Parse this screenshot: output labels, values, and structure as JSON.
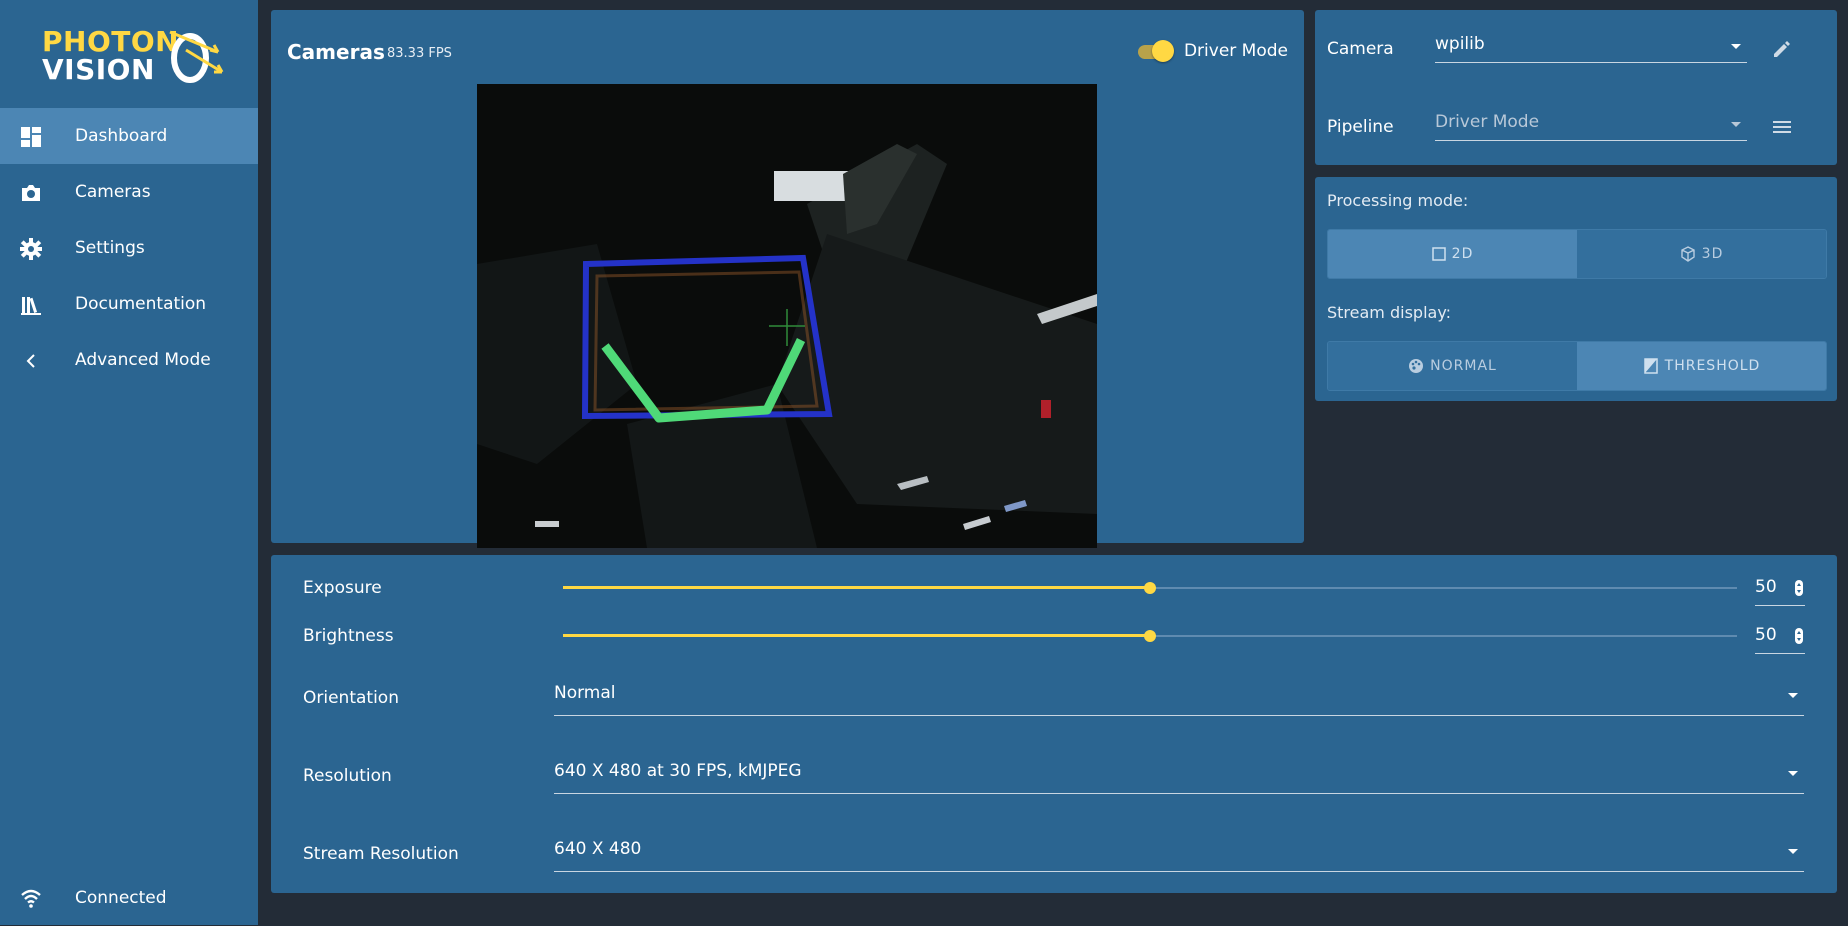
{
  "app": {
    "logo_line1": "PHOTON",
    "logo_line2": "VISION",
    "brand_color": "#ffd843",
    "primary_color": "#2b6591",
    "background_color": "#232c37"
  },
  "sidebar": {
    "items": [
      {
        "label": "Dashboard",
        "icon": "dashboard-icon",
        "active": true
      },
      {
        "label": "Cameras",
        "icon": "camera-icon",
        "active": false
      },
      {
        "label": "Settings",
        "icon": "gear-icon",
        "active": false
      },
      {
        "label": "Documentation",
        "icon": "books-icon",
        "active": false
      },
      {
        "label": "Advanced Mode",
        "icon": "chevron-left-icon",
        "active": false
      }
    ],
    "status": {
      "label": "Connected",
      "icon": "wifi-icon"
    }
  },
  "camera_panel": {
    "title": "Cameras",
    "fps": "83.33 FPS",
    "driver_mode_label": "Driver Mode",
    "driver_mode_on": true
  },
  "camera_settings": {
    "camera_label": "Camera",
    "camera_value": "wpilib",
    "pipeline_label": "Pipeline",
    "pipeline_value": "Driver Mode"
  },
  "modes": {
    "processing_label": "Processing mode:",
    "processing_options": [
      "2D",
      "3D"
    ],
    "processing_selected": "2D",
    "stream_label": "Stream display:",
    "stream_options": [
      "NORMAL",
      "THRESHOLD"
    ],
    "stream_selected": "THRESHOLD"
  },
  "controls": {
    "exposure_label": "Exposure",
    "exposure_value": "50",
    "exposure_fraction": 0.5,
    "brightness_label": "Brightness",
    "brightness_value": "50",
    "brightness_fraction": 0.5,
    "orientation_label": "Orientation",
    "orientation_value": "Normal",
    "resolution_label": "Resolution",
    "resolution_value": "640 X 480 at 30 FPS, kMJPEG",
    "stream_resolution_label": "Stream Resolution",
    "stream_resolution_value": "640 X 480"
  }
}
